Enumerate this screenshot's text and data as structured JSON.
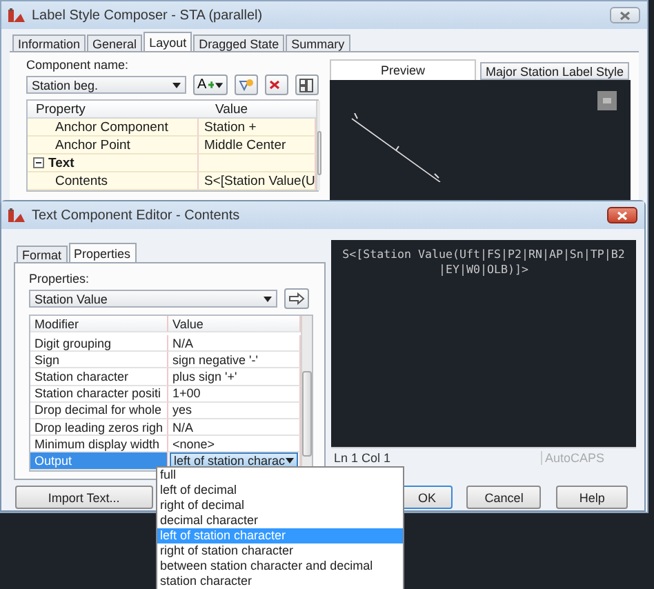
{
  "window": {
    "title": "Label Style Composer - STA (parallel)"
  },
  "tabs": [
    {
      "label": "Information",
      "selected": false
    },
    {
      "label": "General",
      "selected": false
    },
    {
      "label": "Layout",
      "selected": true
    },
    {
      "label": "Dragged State",
      "selected": false
    },
    {
      "label": "Summary",
      "selected": false
    }
  ],
  "component": {
    "label": "Component name:",
    "value": "Station beg.",
    "add_label": "A"
  },
  "property_grid": {
    "columns": [
      "Property",
      "Value"
    ],
    "rows": [
      {
        "kind": "item",
        "name": "Anchor Component",
        "value": "Station +"
      },
      {
        "kind": "item",
        "name": "Anchor Point",
        "value": "Middle Center"
      },
      {
        "kind": "category",
        "name": "Text",
        "expanded": true
      },
      {
        "kind": "item",
        "name": "Contents",
        "value": "S<[Station Value(U"
      }
    ]
  },
  "preview": {
    "label": "Preview",
    "style": "Major Station Label Style"
  },
  "dialog": {
    "title": "Text Component Editor - Contents",
    "tabs": [
      {
        "label": "Format",
        "selected": false
      },
      {
        "label": "Properties",
        "selected": true
      }
    ],
    "properties_label": "Properties:",
    "properties_value": "Station Value",
    "grid": {
      "columns": [
        "Modifier",
        "Value"
      ],
      "rows": [
        {
          "kind": "text",
          "name": "Digit grouping",
          "value": "N/A",
          "selected": false
        },
        {
          "kind": "text",
          "name": "Sign",
          "value": "sign negative '-'",
          "selected": false
        },
        {
          "kind": "text",
          "name": "Station character",
          "value": "plus sign '+'",
          "selected": false
        },
        {
          "kind": "text",
          "name": "Station character positi",
          "value": "1+00",
          "selected": false
        },
        {
          "kind": "text",
          "name": "Drop decimal for whole",
          "value": "yes",
          "selected": false
        },
        {
          "kind": "text",
          "name": "Drop leading zeros righ",
          "value": "N/A",
          "selected": false
        },
        {
          "kind": "text",
          "name": "Minimum display width",
          "value": "<none>",
          "selected": false
        },
        {
          "kind": "combo",
          "name": "Output",
          "value": "left of station charac",
          "selected": true
        }
      ]
    },
    "editor": {
      "lines": [
        "S<[Station Value(Uft|FS|P2|RN|AP|Sn|TP|B2",
        "|EY|W0|OLB)]>"
      ]
    },
    "status": {
      "position": "Ln 1 Col 1",
      "mode": "AutoCAPS"
    },
    "buttons": [
      {
        "kind": "import",
        "label": "Import Text..."
      },
      {
        "kind": "ok",
        "label": "OK"
      },
      {
        "kind": "cancel",
        "label": "Cancel"
      },
      {
        "kind": "help",
        "label": "Help"
      }
    ]
  },
  "dropdown": {
    "items": [
      {
        "label": "full",
        "selected": false
      },
      {
        "label": "left of decimal",
        "selected": false
      },
      {
        "label": "right of decimal",
        "selected": false
      },
      {
        "label": "decimal character",
        "selected": false
      },
      {
        "label": "left of station character",
        "selected": true
      },
      {
        "label": "right of station character",
        "selected": false
      },
      {
        "label": "between station character and decimal",
        "selected": false
      },
      {
        "label": "station character",
        "selected": false
      }
    ]
  }
}
